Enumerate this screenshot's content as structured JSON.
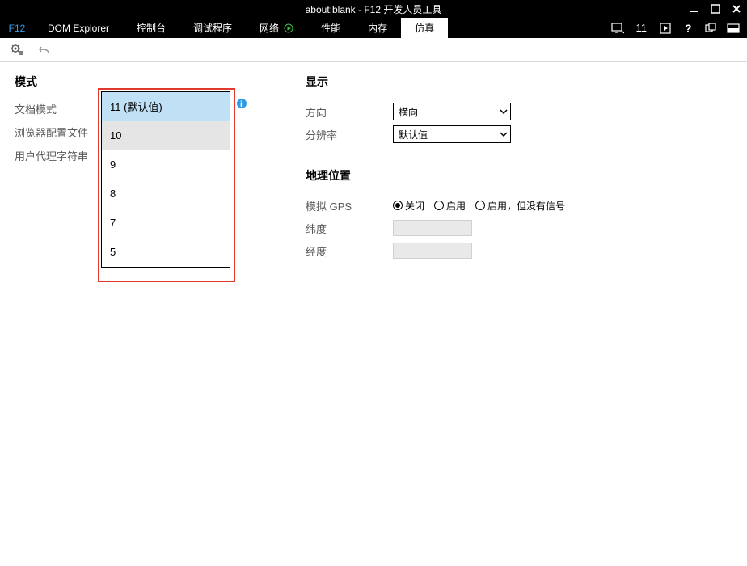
{
  "titlebar": {
    "title": "about:blank - F12 开发人员工具"
  },
  "tabs": {
    "f12": "F12",
    "items": [
      "DOM Explorer",
      "控制台",
      "调试程序",
      "网络",
      "性能",
      "内存",
      "仿真"
    ],
    "active": 6
  },
  "right_status": {
    "doc_mode_num": "11"
  },
  "mode": {
    "title": "模式",
    "labels": [
      "文档模式",
      "浏览器配置文件",
      "用户代理字符串"
    ],
    "dropdown": {
      "items": [
        "11 (默认值)",
        "10",
        "9",
        "8",
        "7",
        "5"
      ],
      "selected": 0,
      "hover": 1
    }
  },
  "display": {
    "title": "显示",
    "orientation": {
      "label": "方向",
      "value": "横向"
    },
    "resolution": {
      "label": "分辨率",
      "value": "默认值"
    }
  },
  "geo": {
    "title": "地理位置",
    "gps_label": "模拟 GPS",
    "options": [
      "关闭",
      "启用",
      "启用，但没有信号"
    ],
    "selected": 0,
    "lat_label": "纬度",
    "lon_label": "经度"
  }
}
